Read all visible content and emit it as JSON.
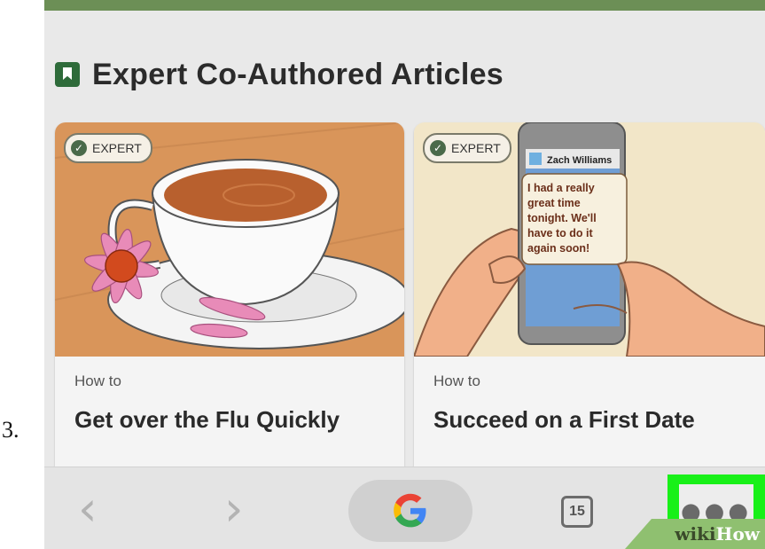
{
  "step_number": "3.",
  "section": {
    "title": "Expert Co-Authored Articles"
  },
  "cards": [
    {
      "badge": "EXPERT",
      "howto": "How to",
      "title": "Get over the Flu Quickly"
    },
    {
      "badge": "EXPERT",
      "howto": "How to",
      "title": "Succeed on a First Date",
      "phone_contact": "Zach Williams",
      "phone_message": "I had a really great time tonight. We'll have to do it again soon!"
    }
  ],
  "toolbar": {
    "back_icon": "chevron-left-icon",
    "forward_icon": "chevron-right-icon",
    "google_icon": "google-g-icon",
    "tab_count": "15",
    "menu_icon": "more-dots-icon",
    "menu_highlight_color": "#18f018"
  },
  "watermark": {
    "part1": "wiki",
    "part2": "How"
  },
  "colors": {
    "top_bar": "#6c8f56",
    "bookmark": "#2e6b3a",
    "background": "#e9e9e9"
  }
}
